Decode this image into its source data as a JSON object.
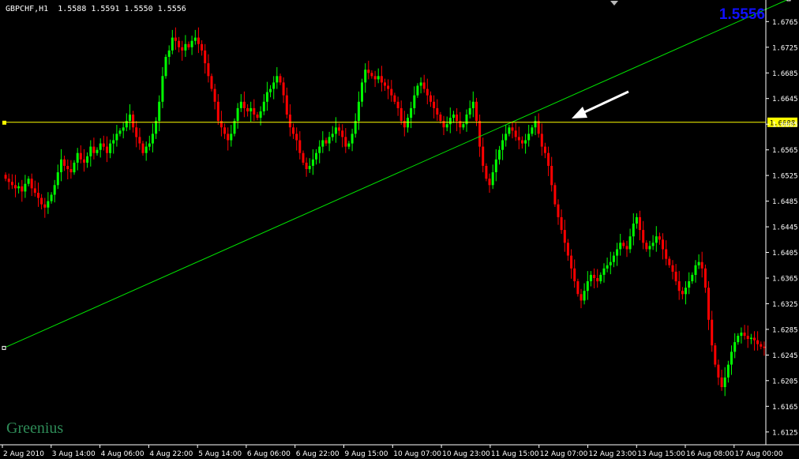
{
  "header": {
    "symbol_timeframe": "GBPCHF,H1",
    "ohlc": "1.5588 1.5591 1.5550 1.5556"
  },
  "bid_display": "1.5556",
  "watermark": "Greenius",
  "colors": {
    "background": "#000000",
    "bull": "#00ff00",
    "bear": "#ff0000",
    "axis": "#ffffff",
    "hline": "#ffff00",
    "trendline": "#00e600",
    "bid": "#1010ff",
    "watermark": "#2e8b57",
    "arrow": "#ffffff"
  },
  "icons": [
    "shift-marker-icon",
    "arrow-annotation-icon"
  ],
  "chart_data": {
    "type": "candlestick",
    "symbol": "GBPCHF",
    "timeframe": "H1",
    "ylim": [
      1.6105,
      1.6795
    ],
    "y_ticks": [
      "1.6765",
      "1.6725",
      "1.6685",
      "1.6645",
      "1.6605",
      "1.6565",
      "1.6525",
      "1.6485",
      "1.6445",
      "1.6405",
      "1.6365",
      "1.6325",
      "1.6285",
      "1.6245",
      "1.6205",
      "1.6165",
      "1.6125"
    ],
    "x_labels": [
      "2 Aug 2010",
      "3 Aug 14:00",
      "4 Aug 06:00",
      "4 Aug 22:00",
      "5 Aug 14:00",
      "6 Aug 06:00",
      "6 Aug 22:00",
      "9 Aug 15:00",
      "10 Aug 07:00",
      "10 Aug 23:00",
      "11 Aug 15:00",
      "12 Aug 07:00",
      "12 Aug 23:00",
      "13 Aug 15:00",
      "16 Aug 08:00",
      "17 Aug 00:00"
    ],
    "horizontal_line": {
      "price": 1.6608,
      "label": "1.6608"
    },
    "trendline": {
      "from": {
        "bar": 0,
        "price": 1.6256
      },
      "to": {
        "bar": 240,
        "price": 1.68
      }
    },
    "closes": [
      1.652,
      1.6515,
      1.651,
      1.6505,
      1.6508,
      1.65,
      1.6512,
      1.652,
      1.6505,
      1.6498,
      1.649,
      1.648,
      1.6475,
      1.6485,
      1.6495,
      1.651,
      1.653,
      1.655,
      1.654,
      1.6535,
      1.653,
      1.6545,
      1.656,
      1.655,
      1.6545,
      1.6555,
      1.657,
      1.656,
      1.6565,
      1.6575,
      1.657,
      1.656,
      1.6575,
      1.658,
      1.659,
      1.6595,
      1.66,
      1.661,
      1.662,
      1.66,
      1.6585,
      1.6575,
      1.656,
      1.657,
      1.6575,
      1.659,
      1.661,
      1.664,
      1.668,
      1.671,
      1.672,
      1.674,
      1.6735,
      1.6725,
      1.672,
      1.673,
      1.6725,
      1.6735,
      1.674,
      1.673,
      1.672,
      1.67,
      1.668,
      1.666,
      1.664,
      1.661,
      1.66,
      1.659,
      1.658,
      1.659,
      1.661,
      1.663,
      1.664,
      1.663,
      1.6625,
      1.663,
      1.662,
      1.6615,
      1.6625,
      1.664,
      1.6655,
      1.666,
      1.667,
      1.668,
      1.667,
      1.665,
      1.662,
      1.66,
      1.659,
      1.658,
      1.656,
      1.6545,
      1.6535,
      1.654,
      1.655,
      1.656,
      1.657,
      1.658,
      1.6575,
      1.6585,
      1.659,
      1.66,
      1.6595,
      1.6585,
      1.657,
      1.6575,
      1.659,
      1.661,
      1.664,
      1.667,
      1.669,
      1.6685,
      1.668,
      1.6675,
      1.668,
      1.667,
      1.6665,
      1.666,
      1.665,
      1.664,
      1.663,
      1.661,
      1.66,
      1.6615,
      1.663,
      1.665,
      1.6665,
      1.667,
      1.666,
      1.665,
      1.664,
      1.663,
      1.662,
      1.661,
      1.66,
      1.6605,
      1.6615,
      1.662,
      1.661,
      1.66,
      1.6605,
      1.662,
      1.663,
      1.664,
      1.661,
      1.657,
      1.654,
      1.652,
      1.651,
      1.653,
      1.655,
      1.6565,
      1.658,
      1.659,
      1.66,
      1.6595,
      1.6585,
      1.658,
      1.6575,
      1.658,
      1.659,
      1.66,
      1.661,
      1.659,
      1.657,
      1.656,
      1.654,
      1.651,
      1.648,
      1.646,
      1.644,
      1.642,
      1.64,
      1.638,
      1.636,
      1.634,
      1.633,
      1.6345,
      1.636,
      1.637,
      1.6365,
      1.636,
      1.637,
      1.638,
      1.6385,
      1.639,
      1.64,
      1.641,
      1.642,
      1.6415,
      1.641,
      1.643,
      1.645,
      1.646,
      1.644,
      1.642,
      1.641,
      1.6415,
      1.642,
      1.643,
      1.6425,
      1.641,
      1.6395,
      1.6385,
      1.6375,
      1.636,
      1.6345,
      1.634,
      1.635,
      1.636,
      1.637,
      1.6385,
      1.639,
      1.638,
      1.635,
      1.63,
      1.626,
      1.623,
      1.621,
      1.6195,
      1.621,
      1.623,
      1.625,
      1.6265,
      1.6275,
      1.628,
      1.6275,
      1.627,
      1.6272,
      1.6268,
      1.6262,
      1.6258,
      1.6256
    ]
  }
}
